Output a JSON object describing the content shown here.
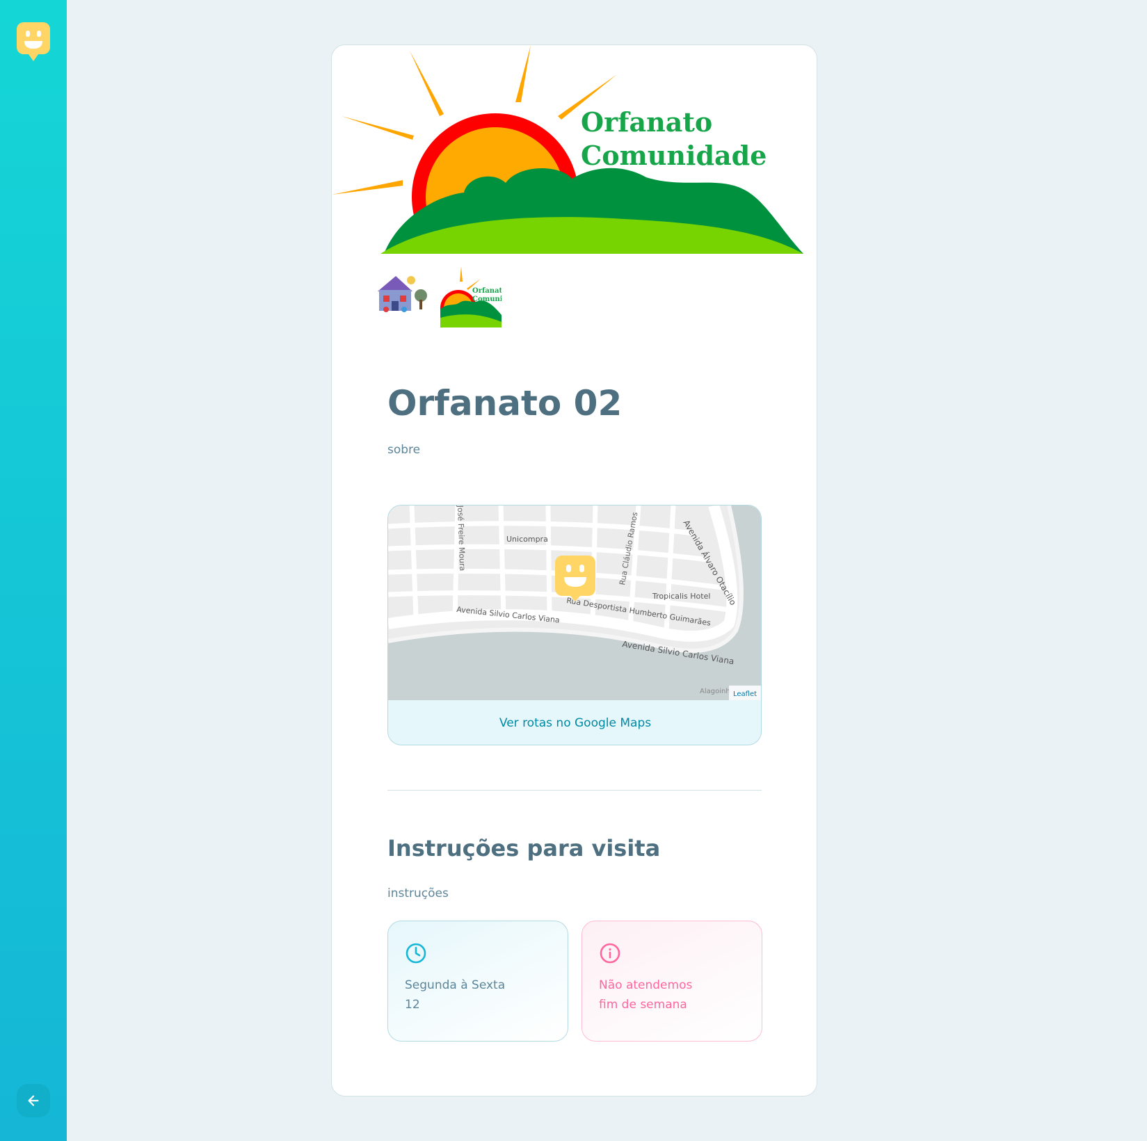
{
  "orphanage": {
    "name": "Orfanato 02",
    "about": "sobre"
  },
  "hero": {
    "logo_line1": "Orfanato",
    "logo_line2": "Comunidade"
  },
  "thumb2": {
    "line1": "Orfanat",
    "line2": "Comuni"
  },
  "map": {
    "labels": {
      "street1": "José Freire Moura",
      "poi1": "Unicompra",
      "street2": "Rua Cláudio Ramos",
      "street3": "Avenida Álvaro Otacílio",
      "poi2": "Tropicalis Hotel",
      "street4": "Rua Desportista Humberto Guimarães",
      "street5": "Avenida Silvio Carlos Viana",
      "street6": "Avenida Silvio Carlos Viana",
      "place": "Alagoinh",
      "attribution": "Leaflet"
    },
    "link_label": "Ver rotas no Google Maps"
  },
  "instructions": {
    "heading": "Instruções para visita",
    "text": "instruções"
  },
  "hours_card": {
    "line1": "Segunda à Sexta",
    "line2": "12"
  },
  "weekend_card": {
    "line1": "Não atendemos",
    "line2": "fim de semana"
  },
  "colors": {
    "sidebar_top": "#15d6d6",
    "sidebar_bottom": "#15b6d6",
    "title": "#4d6f80",
    "text": "#5c8599",
    "link": "#0089a5",
    "marker": "#ffd666",
    "weekend": "#ff669d",
    "hours_icon": "#15b6d6"
  }
}
